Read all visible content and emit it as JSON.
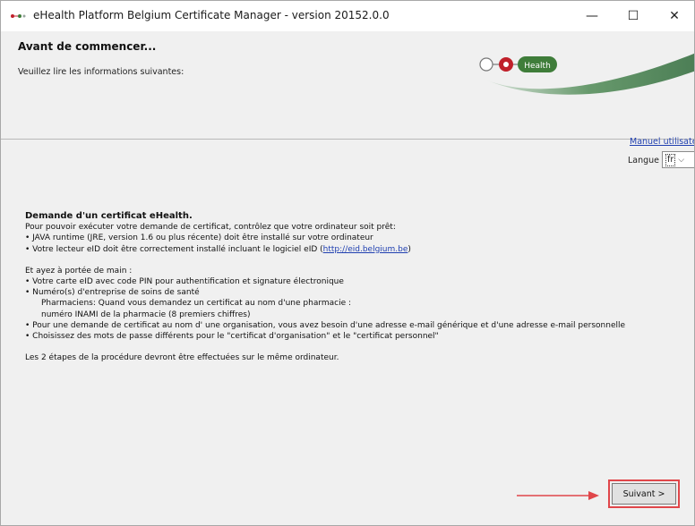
{
  "window": {
    "title": "eHealth Platform Belgium Certificate Manager - version 20152.0.0",
    "minimize_glyph": "—",
    "maximize_glyph": "☐",
    "close_glyph": "✕"
  },
  "header": {
    "title": "Avant de commencer...",
    "subtitle": "Veuillez lire les informations suivantes:",
    "logo_text": "Health"
  },
  "toolbar": {
    "manual_link": "Manuel utilisateur",
    "language_label": "Langue",
    "language_value": "fr"
  },
  "content": {
    "heading": "Demande d'un certificat eHealth.",
    "intro": "Pour pouvoir exécuter votre demande de certificat, contrôlez que votre ordinateur soit prêt:",
    "req_java": "• JAVA runtime (JRE, version 1.6 ou plus récente) doit être installé sur votre ordinateur",
    "req_eid_prefix": "• Votre lecteur eID doit être correctement installé incluant le logiciel eID (",
    "req_eid_link": "http://eid.belgium.be",
    "req_eid_suffix": ")",
    "hand_intro": "Et ayez à portée de main :",
    "hand_card": "• Votre carte eID avec code PIN pour authentification et signature électronique",
    "hand_numbers": "• Numéro(s) d'entreprise de soins de santé",
    "hand_pharma_1": "Pharmaciens: Quand vous demandez un certificat au nom d'une pharmacie :",
    "hand_pharma_2": "numéro INAMI de la pharmacie (8 premiers chiffres)",
    "hand_org": "• Pour une demande de certificat au nom d' une organisation, vous avez besoin d'une adresse e-mail générique et d'une adresse e-mail personnelle",
    "hand_passwords": "• Choisissez des mots de passe différents pour le \"certificat d'organisation\" et le \"certificat personnel\"",
    "closing": "Les 2 étapes de la procédure devront être effectuées sur le même ordinateur."
  },
  "footer": {
    "next_button": "Suivant >",
    "accent_color": "#e0464a"
  }
}
